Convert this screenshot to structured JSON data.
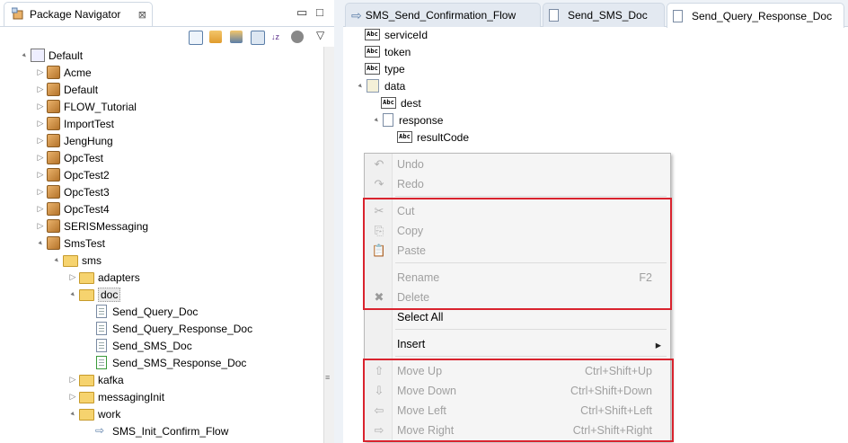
{
  "left_panel": {
    "tab_title": "Package Navigator",
    "close_glyph": "⊠",
    "minimize_glyph": "▭",
    "maximize_glyph": "□",
    "view_menu_glyph": "▽",
    "tree": [
      {
        "label": "Default",
        "icon": "root-icon",
        "twist": "▲",
        "level": 0
      },
      {
        "label": "Acme",
        "icon": "package-icon",
        "twist": "▷",
        "level": 1
      },
      {
        "label": "Default",
        "icon": "package-icon",
        "twist": "▷",
        "level": 1
      },
      {
        "label": "FLOW_Tutorial",
        "icon": "package-icon",
        "twist": "▷",
        "level": 1
      },
      {
        "label": "ImportTest",
        "icon": "package-icon",
        "twist": "▷",
        "level": 1
      },
      {
        "label": "JengHung",
        "icon": "package-icon",
        "twist": "▷",
        "level": 1
      },
      {
        "label": "OpcTest",
        "icon": "package-icon",
        "twist": "▷",
        "level": 1
      },
      {
        "label": "OpcTest2",
        "icon": "package-icon",
        "twist": "▷",
        "level": 1
      },
      {
        "label": "OpcTest3",
        "icon": "package-icon",
        "twist": "▷",
        "level": 1
      },
      {
        "label": "OpcTest4",
        "icon": "package-icon",
        "twist": "▷",
        "level": 1
      },
      {
        "label": "SERISMessaging",
        "icon": "package-icon",
        "twist": "▷",
        "level": 1
      },
      {
        "label": "SmsTest",
        "icon": "package-icon",
        "twist": "▲",
        "level": 1
      },
      {
        "label": "sms",
        "icon": "folder-icon",
        "twist": "▲",
        "level": 2
      },
      {
        "label": "adapters",
        "icon": "folder-icon",
        "twist": "▷",
        "level": 3
      },
      {
        "label": "doc",
        "icon": "folder-icon",
        "twist": "▲",
        "level": 3,
        "selected": true
      },
      {
        "label": "Send_Query_Doc",
        "icon": "document-icon",
        "twist": "",
        "level": 4
      },
      {
        "label": "Send_Query_Response_Doc",
        "icon": "document-icon",
        "twist": "",
        "level": 4
      },
      {
        "label": "Send_SMS_Doc",
        "icon": "document-icon",
        "twist": "",
        "level": 4
      },
      {
        "label": "Send_SMS_Response_Doc",
        "icon": "document-modified-icon",
        "twist": "",
        "level": 4
      },
      {
        "label": "kafka",
        "icon": "folder-icon",
        "twist": "▷",
        "level": 3
      },
      {
        "label": "messagingInit",
        "icon": "folder-icon",
        "twist": "▷",
        "level": 3
      },
      {
        "label": "work",
        "icon": "folder-icon",
        "twist": "▲",
        "level": 3
      },
      {
        "label": "SMS_Init_Confirm_Flow",
        "icon": "flow-icon",
        "twist": "",
        "level": 4
      }
    ],
    "scroll_grip": "≡"
  },
  "right_panel": {
    "tabs": [
      {
        "label": "SMS_Send_Confirmation_Flow",
        "icon": "flow-icon",
        "active": false
      },
      {
        "label": "Send_SMS_Doc",
        "icon": "document-icon",
        "active": false
      },
      {
        "label": "Send_Query_Response_Doc",
        "icon": "document-icon",
        "active": true
      }
    ],
    "fields": [
      {
        "label": "serviceId",
        "icon": "abc-field-icon",
        "twist": "",
        "level": 0
      },
      {
        "label": "token",
        "icon": "abc-field-icon",
        "twist": "",
        "level": 0
      },
      {
        "label": "type",
        "icon": "abc-field-icon",
        "twist": "",
        "level": 0
      },
      {
        "label": "data",
        "icon": "document-list-icon",
        "twist": "▲",
        "level": 0
      },
      {
        "label": "dest",
        "icon": "abc-field-icon",
        "twist": "",
        "level": 1
      },
      {
        "label": "response",
        "icon": "document-field-icon",
        "twist": "▲",
        "level": 1
      },
      {
        "label": "resultCode",
        "icon": "abc-field-icon",
        "twist": "",
        "level": 2
      }
    ],
    "abc_glyph": "Abc"
  },
  "context_menu": {
    "items": [
      {
        "label": "Undo",
        "shortcut": "",
        "icon": "undo-icon",
        "glyph": "↶",
        "enabled": false
      },
      {
        "label": "Redo",
        "shortcut": "",
        "icon": "redo-icon",
        "glyph": "↷",
        "enabled": false
      },
      {
        "label": "Cut",
        "shortcut": "",
        "icon": "scissors-icon",
        "glyph": "✂",
        "enabled": false
      },
      {
        "label": "Copy",
        "shortcut": "",
        "icon": "copy-icon",
        "glyph": "⎘",
        "enabled": false
      },
      {
        "label": "Paste",
        "shortcut": "",
        "icon": "paste-icon",
        "glyph": "📋",
        "enabled": false
      },
      {
        "label": "Rename",
        "shortcut": "F2",
        "icon": "",
        "glyph": "",
        "enabled": false
      },
      {
        "label": "Delete",
        "shortcut": "",
        "icon": "delete-icon",
        "glyph": "✖",
        "enabled": false
      },
      {
        "label": "Select All",
        "shortcut": "",
        "icon": "",
        "glyph": "",
        "enabled": true
      },
      {
        "label": "Insert",
        "shortcut": "",
        "icon": "",
        "glyph": "",
        "enabled": true,
        "submenu_arrow": "▸"
      },
      {
        "label": "Move Up",
        "shortcut": "Ctrl+Shift+Up",
        "icon": "move-up-icon",
        "glyph": "⇧",
        "enabled": false
      },
      {
        "label": "Move Down",
        "shortcut": "Ctrl+Shift+Down",
        "icon": "move-down-icon",
        "glyph": "⇩",
        "enabled": false
      },
      {
        "label": "Move Left",
        "shortcut": "Ctrl+Shift+Left",
        "icon": "move-left-icon",
        "glyph": "⇦",
        "enabled": false
      },
      {
        "label": "Move Right",
        "shortcut": "Ctrl+Shift+Right",
        "icon": "move-right-icon",
        "glyph": "⇨",
        "enabled": false
      }
    ]
  },
  "colors": {
    "highlight_box": "#d9232e",
    "disabled_text": "#a0a0a0",
    "tab_border": "#cfd8e3"
  }
}
